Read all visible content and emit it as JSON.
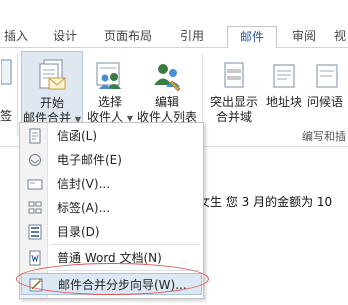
{
  "tabs": [
    {
      "label": "插入",
      "active": false
    },
    {
      "label": "设计",
      "active": false
    },
    {
      "label": "页面布局",
      "active": false
    },
    {
      "label": "引用",
      "active": false
    },
    {
      "label": "邮件",
      "active": true
    },
    {
      "label": "审阅",
      "active": false
    },
    {
      "label": "视",
      "active": false
    }
  ],
  "ribbon": {
    "partial_left_label": "签",
    "start_merge": {
      "line1": "开始",
      "line2": "邮件合并"
    },
    "select_recipients": {
      "line1": "选择",
      "line2": "收件人"
    },
    "edit_recipients": {
      "line1": "编辑",
      "line2": "收件人列表"
    },
    "highlight_fields": {
      "line1": "突出显示",
      "line2": "合并域"
    },
    "address_block": {
      "line1": "地址块"
    },
    "greeting_line": {
      "line1": "问候语"
    },
    "group_label": "编写和插"
  },
  "menu": {
    "items": [
      {
        "label": "信函(L)",
        "icon": "letter-icon"
      },
      {
        "label": "电子邮件(E)",
        "icon": "email-icon"
      },
      {
        "label": "信封(V)...",
        "icon": "envelope-icon"
      },
      {
        "label": "标签(A)...",
        "icon": "label-icon"
      },
      {
        "label": "目录(D)",
        "icon": "directory-icon"
      },
      {
        "label": "普通 Word 文档(N)",
        "icon": "normal-document-icon"
      },
      {
        "label": "邮件合并分步向导(W)...",
        "icon": "wizard-icon"
      }
    ]
  },
  "document": {
    "visible_text": "女生 您 3 月的金额为 10"
  },
  "colors": {
    "accent": "#2b579a",
    "highlight_oval": "#d9534f",
    "menu_hover": "#dde8f5"
  }
}
